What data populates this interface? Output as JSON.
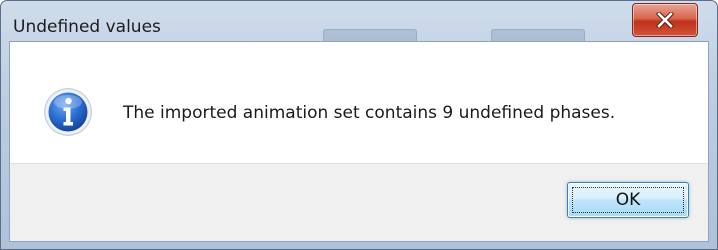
{
  "dialog": {
    "title": "Undefined values",
    "close_icon": "close-icon",
    "message_icon": "info-icon",
    "message": "The imported animation set contains 9 undefined phases.",
    "ok_label": "OK"
  },
  "colors": {
    "titlebar": "#bccde2",
    "close_button": "#c0311a",
    "content_background": "#ffffff",
    "footer_background": "#f0f0f0",
    "info_icon": "#1f5ab8",
    "ok_border": "#3c7fb1"
  }
}
